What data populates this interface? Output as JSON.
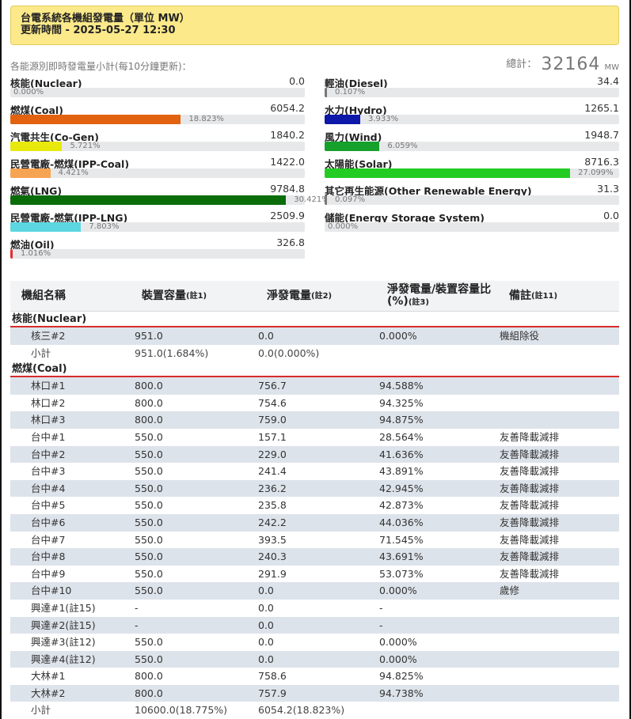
{
  "banner": {
    "title": "台電系統各機組發電量（單位 MW）",
    "updated": "更新時間 - 2025-05-27 12:30"
  },
  "summary": {
    "note": "各能源別即時發電量小計(每10分鐘更新)：",
    "total_label": "總計：",
    "total_value": "32164",
    "total_unit": "MW"
  },
  "energy_left": [
    {
      "name": "核能(Nuclear)",
      "value": "0.0",
      "pct_text": "0.000%",
      "pct": 0.0,
      "color": "#1f5fbf"
    },
    {
      "name": "燃煤(Coal)",
      "value": "6054.2",
      "pct_text": "18.823%",
      "pct": 18.823,
      "color": "#e2620f"
    },
    {
      "name": "汽電共生(Co-Gen)",
      "value": "1840.2",
      "pct_text": "5.721%",
      "pct": 5.721,
      "color": "#e8e80c"
    },
    {
      "name": "民營電廠-燃煤(IPP-Coal)",
      "value": "1422.0",
      "pct_text": "4.421%",
      "pct": 4.421,
      "color": "#f7a452"
    },
    {
      "name": "燃氣(LNG)",
      "value": "9784.8",
      "pct_text": "30.421%",
      "pct": 30.421,
      "color": "#0a6d0a"
    },
    {
      "name": "民營電廠-燃氣(IPP-LNG)",
      "value": "2509.9",
      "pct_text": "7.803%",
      "pct": 7.803,
      "color": "#5cd6e0"
    },
    {
      "name": "燃油(Oil)",
      "value": "326.8",
      "pct_text": "1.016%",
      "pct": 1.016,
      "color": "#e03030"
    }
  ],
  "energy_right": [
    {
      "name": "輕油(Diesel)",
      "value": "34.4",
      "pct_text": "0.107%",
      "pct": 0.107,
      "color": "#777777"
    },
    {
      "name": "水力(Hydro)",
      "value": "1265.1",
      "pct_text": "3.933%",
      "pct": 3.933,
      "color": "#0d17a8"
    },
    {
      "name": "風力(Wind)",
      "value": "1948.7",
      "pct_text": "6.059%",
      "pct": 6.059,
      "color": "#16a02c"
    },
    {
      "name": "太陽能(Solar)",
      "value": "8716.3",
      "pct_text": "27.099%",
      "pct": 27.099,
      "color": "#22cc22"
    },
    {
      "name": "其它再生能源(Other Renewable Energy)",
      "value": "31.3",
      "pct_text": "0.097%",
      "pct": 0.097,
      "color": "#777777"
    },
    {
      "name": "儲能(Energy Storage System)",
      "value": "0.0",
      "pct_text": "0.000%",
      "pct": 0.0,
      "color": "#777777"
    }
  ],
  "table": {
    "headers": [
      {
        "label": "機組名稱",
        "note": ""
      },
      {
        "label": "裝置容量",
        "note": "(註1)"
      },
      {
        "label": "淨發電量",
        "note": "(註2)"
      },
      {
        "label": "淨發電量/裝置容量比(%)",
        "note": "(註3)"
      },
      {
        "label": "備註",
        "note": "(註11)"
      }
    ],
    "groups": [
      {
        "name": "核能(Nuclear)",
        "rows": [
          {
            "unit": "核三#2",
            "capacity": "951.0",
            "output": "0.0",
            "ratio": "0.000%",
            "note": "機組除役"
          },
          {
            "unit": "小計",
            "capacity": "951.0(1.684%)",
            "output": "0.0(0.000%)",
            "ratio": "",
            "note": ""
          }
        ]
      },
      {
        "name": "燃煤(Coal)",
        "rows": [
          {
            "unit": "林口#1",
            "capacity": "800.0",
            "output": "756.7",
            "ratio": "94.588%",
            "note": ""
          },
          {
            "unit": "林口#2",
            "capacity": "800.0",
            "output": "754.6",
            "ratio": "94.325%",
            "note": ""
          },
          {
            "unit": "林口#3",
            "capacity": "800.0",
            "output": "759.0",
            "ratio": "94.875%",
            "note": ""
          },
          {
            "unit": "台中#1",
            "capacity": "550.0",
            "output": "157.1",
            "ratio": "28.564%",
            "note": "友善降載減排"
          },
          {
            "unit": "台中#2",
            "capacity": "550.0",
            "output": "229.0",
            "ratio": "41.636%",
            "note": "友善降載減排"
          },
          {
            "unit": "台中#3",
            "capacity": "550.0",
            "output": "241.4",
            "ratio": "43.891%",
            "note": "友善降載減排"
          },
          {
            "unit": "台中#4",
            "capacity": "550.0",
            "output": "236.2",
            "ratio": "42.945%",
            "note": "友善降載減排"
          },
          {
            "unit": "台中#5",
            "capacity": "550.0",
            "output": "235.8",
            "ratio": "42.873%",
            "note": "友善降載減排"
          },
          {
            "unit": "台中#6",
            "capacity": "550.0",
            "output": "242.2",
            "ratio": "44.036%",
            "note": "友善降載減排"
          },
          {
            "unit": "台中#7",
            "capacity": "550.0",
            "output": "393.5",
            "ratio": "71.545%",
            "note": "友善降載減排"
          },
          {
            "unit": "台中#8",
            "capacity": "550.0",
            "output": "240.3",
            "ratio": "43.691%",
            "note": "友善降載減排"
          },
          {
            "unit": "台中#9",
            "capacity": "550.0",
            "output": "291.9",
            "ratio": "53.073%",
            "note": "友善降載減排"
          },
          {
            "unit": "台中#10",
            "capacity": "550.0",
            "output": "0.0",
            "ratio": "0.000%",
            "note": "歲修"
          },
          {
            "unit": "興達#1(註15)",
            "capacity": "-",
            "output": "0.0",
            "ratio": "-",
            "note": ""
          },
          {
            "unit": "興達#2(註15)",
            "capacity": "-",
            "output": "0.0",
            "ratio": "-",
            "note": ""
          },
          {
            "unit": "興達#3(註12)",
            "capacity": "550.0",
            "output": "0.0",
            "ratio": "0.000%",
            "note": ""
          },
          {
            "unit": "興達#4(註12)",
            "capacity": "550.0",
            "output": "0.0",
            "ratio": "0.000%",
            "note": ""
          },
          {
            "unit": "大林#1",
            "capacity": "800.0",
            "output": "758.6",
            "ratio": "94.825%",
            "note": ""
          },
          {
            "unit": "大林#2",
            "capacity": "800.0",
            "output": "757.9",
            "ratio": "94.738%",
            "note": ""
          },
          {
            "unit": "小計",
            "capacity": "10600.0(18.775%)",
            "output": "6054.2(18.823%)",
            "ratio": "",
            "note": ""
          }
        ]
      }
    ]
  }
}
